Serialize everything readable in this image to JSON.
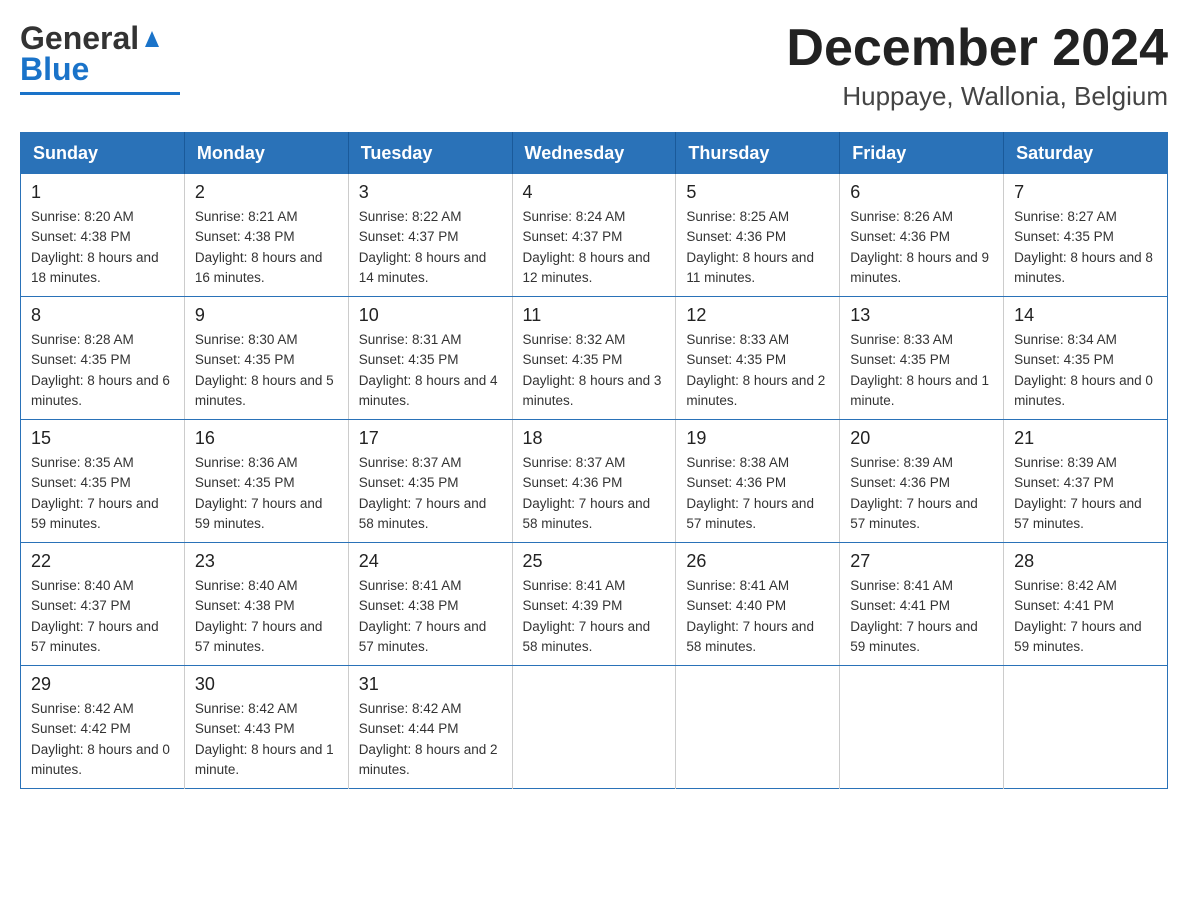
{
  "header": {
    "logo_general": "General",
    "logo_blue": "Blue",
    "month_year": "December 2024",
    "location": "Huppaye, Wallonia, Belgium"
  },
  "days_of_week": [
    "Sunday",
    "Monday",
    "Tuesday",
    "Wednesday",
    "Thursday",
    "Friday",
    "Saturday"
  ],
  "weeks": [
    [
      {
        "day": "1",
        "sunrise": "Sunrise: 8:20 AM",
        "sunset": "Sunset: 4:38 PM",
        "daylight": "Daylight: 8 hours and 18 minutes."
      },
      {
        "day": "2",
        "sunrise": "Sunrise: 8:21 AM",
        "sunset": "Sunset: 4:38 PM",
        "daylight": "Daylight: 8 hours and 16 minutes."
      },
      {
        "day": "3",
        "sunrise": "Sunrise: 8:22 AM",
        "sunset": "Sunset: 4:37 PM",
        "daylight": "Daylight: 8 hours and 14 minutes."
      },
      {
        "day": "4",
        "sunrise": "Sunrise: 8:24 AM",
        "sunset": "Sunset: 4:37 PM",
        "daylight": "Daylight: 8 hours and 12 minutes."
      },
      {
        "day": "5",
        "sunrise": "Sunrise: 8:25 AM",
        "sunset": "Sunset: 4:36 PM",
        "daylight": "Daylight: 8 hours and 11 minutes."
      },
      {
        "day": "6",
        "sunrise": "Sunrise: 8:26 AM",
        "sunset": "Sunset: 4:36 PM",
        "daylight": "Daylight: 8 hours and 9 minutes."
      },
      {
        "day": "7",
        "sunrise": "Sunrise: 8:27 AM",
        "sunset": "Sunset: 4:35 PM",
        "daylight": "Daylight: 8 hours and 8 minutes."
      }
    ],
    [
      {
        "day": "8",
        "sunrise": "Sunrise: 8:28 AM",
        "sunset": "Sunset: 4:35 PM",
        "daylight": "Daylight: 8 hours and 6 minutes."
      },
      {
        "day": "9",
        "sunrise": "Sunrise: 8:30 AM",
        "sunset": "Sunset: 4:35 PM",
        "daylight": "Daylight: 8 hours and 5 minutes."
      },
      {
        "day": "10",
        "sunrise": "Sunrise: 8:31 AM",
        "sunset": "Sunset: 4:35 PM",
        "daylight": "Daylight: 8 hours and 4 minutes."
      },
      {
        "day": "11",
        "sunrise": "Sunrise: 8:32 AM",
        "sunset": "Sunset: 4:35 PM",
        "daylight": "Daylight: 8 hours and 3 minutes."
      },
      {
        "day": "12",
        "sunrise": "Sunrise: 8:33 AM",
        "sunset": "Sunset: 4:35 PM",
        "daylight": "Daylight: 8 hours and 2 minutes."
      },
      {
        "day": "13",
        "sunrise": "Sunrise: 8:33 AM",
        "sunset": "Sunset: 4:35 PM",
        "daylight": "Daylight: 8 hours and 1 minute."
      },
      {
        "day": "14",
        "sunrise": "Sunrise: 8:34 AM",
        "sunset": "Sunset: 4:35 PM",
        "daylight": "Daylight: 8 hours and 0 minutes."
      }
    ],
    [
      {
        "day": "15",
        "sunrise": "Sunrise: 8:35 AM",
        "sunset": "Sunset: 4:35 PM",
        "daylight": "Daylight: 7 hours and 59 minutes."
      },
      {
        "day": "16",
        "sunrise": "Sunrise: 8:36 AM",
        "sunset": "Sunset: 4:35 PM",
        "daylight": "Daylight: 7 hours and 59 minutes."
      },
      {
        "day": "17",
        "sunrise": "Sunrise: 8:37 AM",
        "sunset": "Sunset: 4:35 PM",
        "daylight": "Daylight: 7 hours and 58 minutes."
      },
      {
        "day": "18",
        "sunrise": "Sunrise: 8:37 AM",
        "sunset": "Sunset: 4:36 PM",
        "daylight": "Daylight: 7 hours and 58 minutes."
      },
      {
        "day": "19",
        "sunrise": "Sunrise: 8:38 AM",
        "sunset": "Sunset: 4:36 PM",
        "daylight": "Daylight: 7 hours and 57 minutes."
      },
      {
        "day": "20",
        "sunrise": "Sunrise: 8:39 AM",
        "sunset": "Sunset: 4:36 PM",
        "daylight": "Daylight: 7 hours and 57 minutes."
      },
      {
        "day": "21",
        "sunrise": "Sunrise: 8:39 AM",
        "sunset": "Sunset: 4:37 PM",
        "daylight": "Daylight: 7 hours and 57 minutes."
      }
    ],
    [
      {
        "day": "22",
        "sunrise": "Sunrise: 8:40 AM",
        "sunset": "Sunset: 4:37 PM",
        "daylight": "Daylight: 7 hours and 57 minutes."
      },
      {
        "day": "23",
        "sunrise": "Sunrise: 8:40 AM",
        "sunset": "Sunset: 4:38 PM",
        "daylight": "Daylight: 7 hours and 57 minutes."
      },
      {
        "day": "24",
        "sunrise": "Sunrise: 8:41 AM",
        "sunset": "Sunset: 4:38 PM",
        "daylight": "Daylight: 7 hours and 57 minutes."
      },
      {
        "day": "25",
        "sunrise": "Sunrise: 8:41 AM",
        "sunset": "Sunset: 4:39 PM",
        "daylight": "Daylight: 7 hours and 58 minutes."
      },
      {
        "day": "26",
        "sunrise": "Sunrise: 8:41 AM",
        "sunset": "Sunset: 4:40 PM",
        "daylight": "Daylight: 7 hours and 58 minutes."
      },
      {
        "day": "27",
        "sunrise": "Sunrise: 8:41 AM",
        "sunset": "Sunset: 4:41 PM",
        "daylight": "Daylight: 7 hours and 59 minutes."
      },
      {
        "day": "28",
        "sunrise": "Sunrise: 8:42 AM",
        "sunset": "Sunset: 4:41 PM",
        "daylight": "Daylight: 7 hours and 59 minutes."
      }
    ],
    [
      {
        "day": "29",
        "sunrise": "Sunrise: 8:42 AM",
        "sunset": "Sunset: 4:42 PM",
        "daylight": "Daylight: 8 hours and 0 minutes."
      },
      {
        "day": "30",
        "sunrise": "Sunrise: 8:42 AM",
        "sunset": "Sunset: 4:43 PM",
        "daylight": "Daylight: 8 hours and 1 minute."
      },
      {
        "day": "31",
        "sunrise": "Sunrise: 8:42 AM",
        "sunset": "Sunset: 4:44 PM",
        "daylight": "Daylight: 8 hours and 2 minutes."
      },
      null,
      null,
      null,
      null
    ]
  ]
}
